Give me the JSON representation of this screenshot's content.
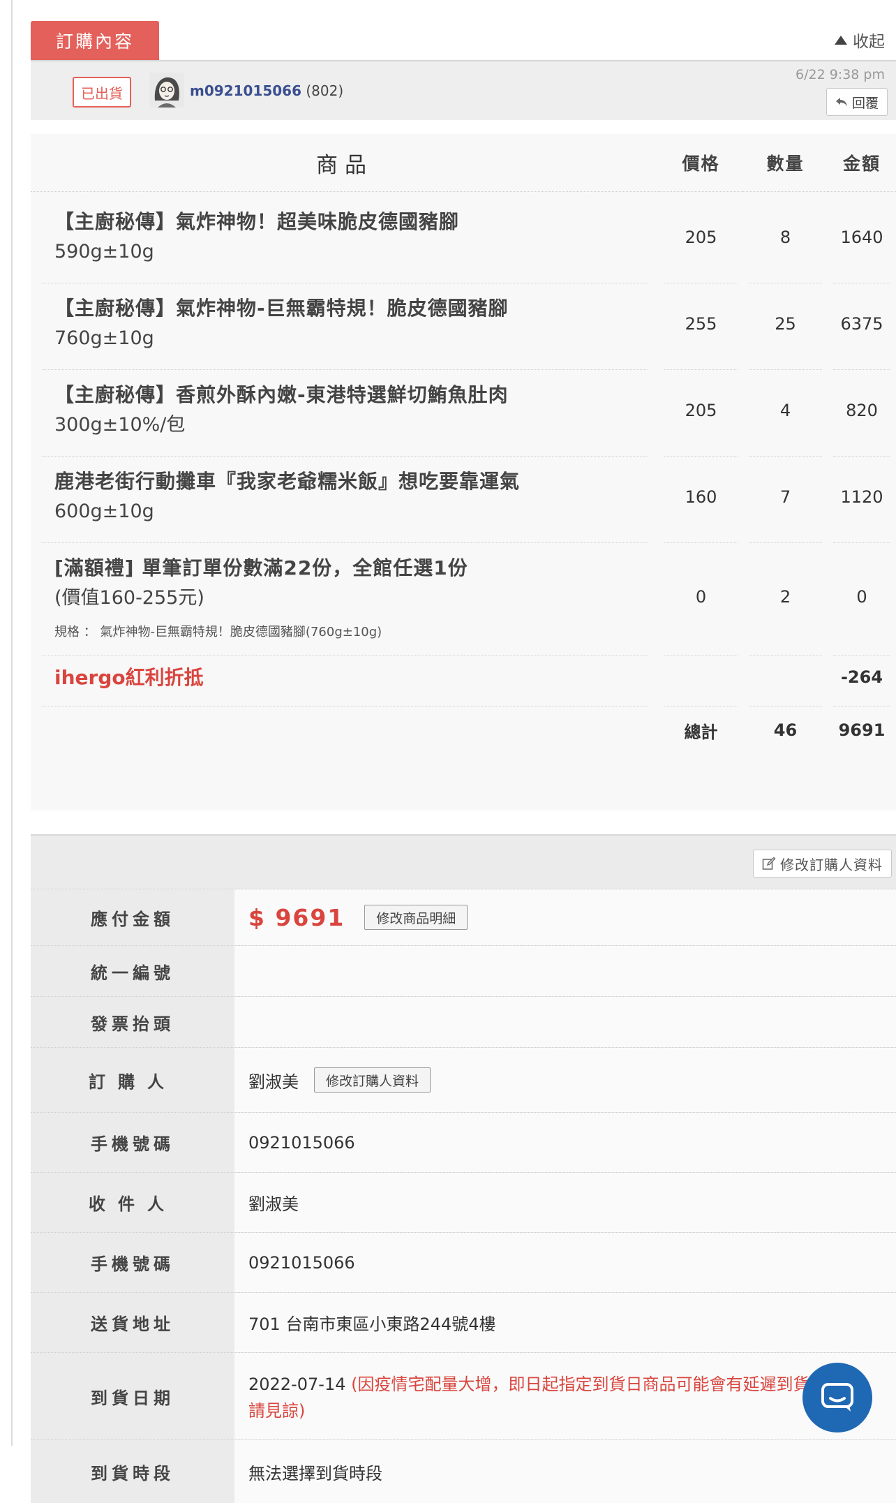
{
  "header": {
    "tab_label": "訂購內容",
    "collapse_label": "收起"
  },
  "seller": {
    "status_badge": "已出貨",
    "name": "m0921015066",
    "count": "(802)",
    "time": "6/22  9:38 pm",
    "reply_label": "回覆"
  },
  "products": {
    "headers": {
      "name": "商品",
      "price": "價格",
      "qty": "數量",
      "amount": "金額"
    },
    "items": [
      {
        "name": "【主廚秘傳】氣炸神物！超美味脆皮德國豬腳",
        "size": "590g±10g",
        "price": "205",
        "qty": "8",
        "amount": "1640"
      },
      {
        "name": "【主廚秘傳】氣炸神物-巨無霸特規！脆皮德國豬腳",
        "size": "760g±10g",
        "price": "255",
        "qty": "25",
        "amount": "6375"
      },
      {
        "name": "【主廚秘傳】香煎外酥內嫩-東港特選鮮切鮪魚肚肉",
        "size": "300g±10%/包",
        "price": "205",
        "qty": "4",
        "amount": "820"
      },
      {
        "name": "鹿港老街行動攤車『我家老爺糯米飯』想吃要靠運氣",
        "size": "600g±10g",
        "price": "160",
        "qty": "7",
        "amount": "1120"
      },
      {
        "name": "[滿額禮] 單筆訂單份數滿22份，全館任選1份",
        "size": "(價值160-255元)",
        "spec": "規格 ： 氣炸神物-巨無霸特規！脆皮德國豬腳(760g±10g)",
        "price": "0",
        "qty": "2",
        "amount": "0"
      }
    ],
    "discount": {
      "label": "ihergo紅利折抵",
      "amount": "-264"
    },
    "total": {
      "label": "總計",
      "qty": "46",
      "amount": "9691"
    }
  },
  "order": {
    "edit_buyer_top_label": "修改訂購人資料",
    "rows": {
      "payable_label": "應付金額",
      "payable_value": "$ 9691",
      "edit_items_label": "修改商品明細",
      "tax_id_label": "統一編號",
      "tax_id_value": "",
      "invoice_title_label": "發票抬頭",
      "invoice_title_value": "",
      "buyer_label": "訂購人",
      "buyer_value": "劉淑美",
      "edit_buyer_label": "修改訂購人資料",
      "phone1_label": "手機號碼",
      "phone1_value": "0921015066",
      "recipient_label": "收件人",
      "recipient_value": "劉淑美",
      "phone2_label": "手機號碼",
      "phone2_value": "0921015066",
      "address_label": "送貨地址",
      "address_value": "701 台南市東區小東路244號4樓",
      "date_label": "到貨日期",
      "date_value": "2022-07-14",
      "date_note": "(因疫情宅配量大增，即日起指定到貨日商品可能會有延遲到貨之情況，請見諒)",
      "slot_label": "到貨時段",
      "slot_value": "無法選擇到貨時段"
    }
  },
  "colors": {
    "accent": "#e4605a",
    "warning": "#d9453e",
    "link": "#3a4f8f",
    "chat": "#1f68b4"
  },
  "icons": {
    "collapse": "triangle-up-icon",
    "reply": "reply-arrow-icon",
    "edit": "edit-pencil-icon",
    "chat": "chat-bubble-icon"
  }
}
